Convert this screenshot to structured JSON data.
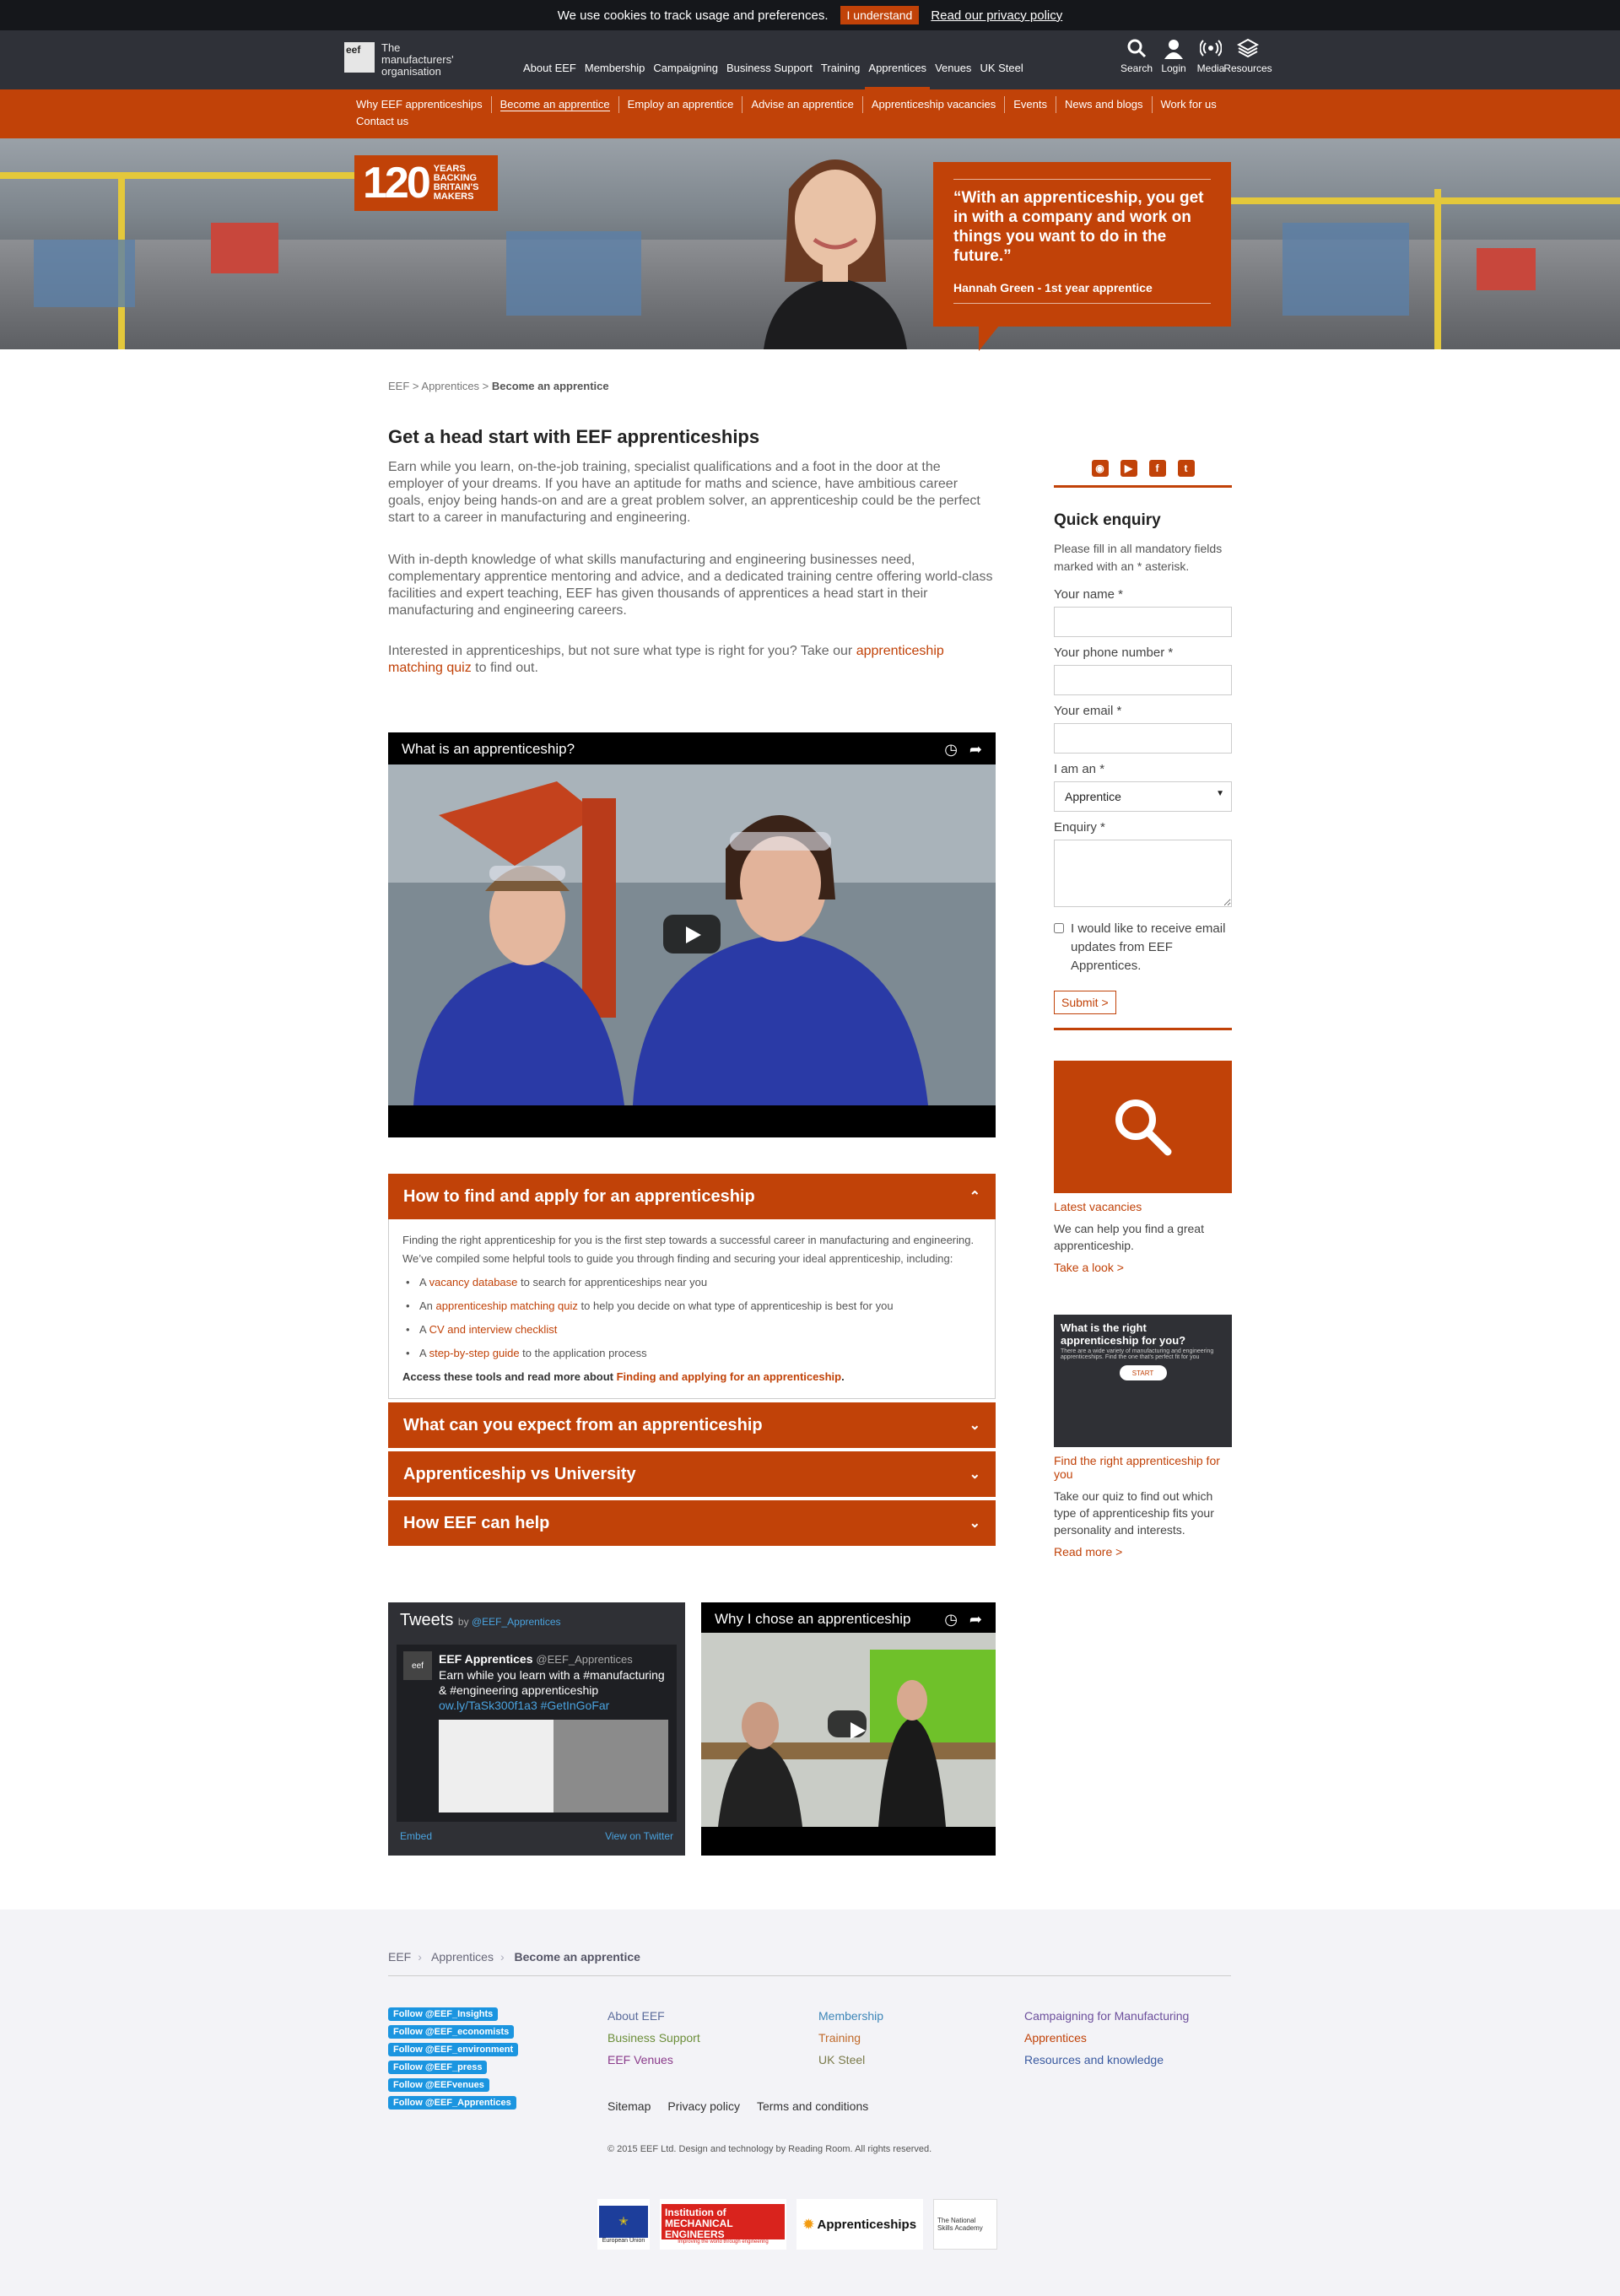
{
  "cookie": {
    "text": "We use cookies to track usage and preferences.",
    "button": "I understand",
    "link": "Read our privacy policy"
  },
  "logo": {
    "mark": "eef",
    "text": "The manufacturers' organisation"
  },
  "main_nav": [
    "About EEF",
    "Membership",
    "Campaigning",
    "Business Support",
    "Training",
    "Apprentices",
    "Venues",
    "UK Steel"
  ],
  "tools": [
    {
      "icon": "search-icon",
      "label": "Search"
    },
    {
      "icon": "user-icon",
      "label": "Login"
    },
    {
      "icon": "broadcast-icon",
      "label": "Media"
    },
    {
      "icon": "layers-icon",
      "label": "Resources"
    }
  ],
  "sub_nav": [
    "Why EEF apprenticeships",
    "Become an apprentice",
    "Employ an apprentice",
    "Advise an apprentice",
    "Apprenticeship vacancies",
    "Events",
    "News and blogs",
    "Work for us",
    "Contact us"
  ],
  "hero": {
    "badge_num": "120",
    "badge_cap": "YEARS BACKING BRITAIN'S MAKERS",
    "quote": "“With an apprenticeship, you get in with a company and work on things you want to do in the future.”",
    "attribution": "Hannah Green - 1st year apprentice"
  },
  "breadcrumb": {
    "a": "EEF",
    "b": "Apprentices",
    "c": "Become an apprentice"
  },
  "main": {
    "title": "Get a head start with EEF apprenticeships",
    "p1": "Earn while you learn, on-the-job training, specialist qualifications and a foot in the door at the employer of your dreams. If you have an aptitude for maths and science, have ambitious career goals, enjoy being hands-on and are a great problem solver, an apprenticeship could be the perfect start to a career in manufacturing and engineering.",
    "p2": "With in-depth knowledge of what skills manufacturing and engineering businesses need, complementary apprentice mentoring and advice, and a dedicated training centre offering world-class facilities and expert teaching, EEF has given thousands of apprentices a head start in their manufacturing and engineering careers.",
    "p3a": "Interested in apprenticeships, but not sure what type is right for you? Take our",
    "p3link": "apprenticeship matching quiz",
    "p3b": "to find out.",
    "video1_title": "What is an apprenticeship?",
    "video2_title": "Why I chose an apprenticeship"
  },
  "accordion": {
    "h1": "How to find and apply for an apprenticeship",
    "intro": "Finding the right apprenticeship for you is the first step towards a successful career in manufacturing and engineering. We’ve compiled some helpful tools to guide you through finding and securing your ideal apprenticeship, including:",
    "items": [
      {
        "pre": "A",
        "link": "vacancy database",
        "post": "to search for apprenticeships near you"
      },
      {
        "pre": "An",
        "link": "apprenticeship matching quiz",
        "post": "to help you decide on what type of apprenticeship is best for you"
      },
      {
        "pre": "A",
        "link": "CV and interview checklist",
        "post": ""
      },
      {
        "pre": "A",
        "link": "step-by-step guide",
        "post": "to the application process"
      }
    ],
    "access": "Access these tools and read more about",
    "access_link": "Finding and applying for an apprenticeship",
    "h2": "What can you expect from an apprenticeship",
    "h3": "Apprenticeship vs University",
    "h4": "How EEF can help"
  },
  "tweets": {
    "title": "Tweets",
    "by": "by",
    "handle": "@EEF_Apprentices",
    "name": "EEF Apprentices",
    "text": "Earn while you learn with a #manufacturing & #engineering apprenticeship",
    "link": "ow.ly/TaSk300f1a3 #GetInGoFar",
    "embed": "Embed",
    "view": "View on Twitter"
  },
  "sidebar": {
    "qe_title": "Quick enquiry",
    "qe_note": "Please fill in all mandatory fields marked with an * asterisk.",
    "name": "Your name *",
    "phone": "Your phone number *",
    "email": "Your email *",
    "iam": "I am an *",
    "iam_value": "Apprentice",
    "enquiry": "Enquiry *",
    "optin": "I would like to receive email updates from EEF Apprentices.",
    "submit": "Submit >",
    "p1_title": "Latest vacancies",
    "p1_text": "We can help you find a great apprenticeship.",
    "p1_more": "Take a look >",
    "p2_img_title": "What is the right apprenticeship for you?",
    "p2_img_sub": "There are a wide variety of manufacturing and engineering apprenticeships. Find the one that's perfect fit for you",
    "p2_img_btn": "START",
    "p2_title": "Find the right apprenticeship for you",
    "p2_text": "Take our quiz to find out which type of apprenticeship fits your personality and interests.",
    "p2_more": "Read more >"
  },
  "footer": {
    "crumbs": [
      "EEF",
      "Apprentices",
      "Become an apprentice"
    ],
    "follows": [
      "Follow @EEF_Insights",
      "Follow @EEF_economists",
      "Follow @EEF_environment",
      "Follow @EEF_press",
      "Follow @EEFvenues",
      "Follow @EEF_Apprentices"
    ],
    "links": [
      {
        "label": "About EEF",
        "color": "#5a6b9b"
      },
      {
        "label": "Membership",
        "color": "#3d86b8"
      },
      {
        "label": "Campaigning for Manufacturing",
        "color": "#6c4f9c"
      },
      {
        "label": "Business Support",
        "color": "#6c8e3a"
      },
      {
        "label": "Training",
        "color": "#c06a2b"
      },
      {
        "label": "Apprentices",
        "color": "#c14208"
      },
      {
        "label": "EEF Venues",
        "color": "#8a3a8a"
      },
      {
        "label": "UK Steel",
        "color": "#7a7a4a"
      },
      {
        "label": "Resources and knowledge",
        "color": "#3a5aa0"
      }
    ],
    "legal": [
      "Sitemap",
      "Privacy policy",
      "Terms and conditions"
    ],
    "copyright": "© 2015 EEF Ltd. Design and technology by Reading Room. All rights reserved.",
    "logos": {
      "eu": "European Union",
      "imeche": "Institution of MECHANICAL ENGINEERS",
      "imeche_sub": "Improving the world through engineering",
      "appr": "Apprenticeships",
      "nsa": "The National Skills Academy"
    }
  },
  "colors": {
    "brand": "#c14208",
    "dark": "#2f3138"
  }
}
